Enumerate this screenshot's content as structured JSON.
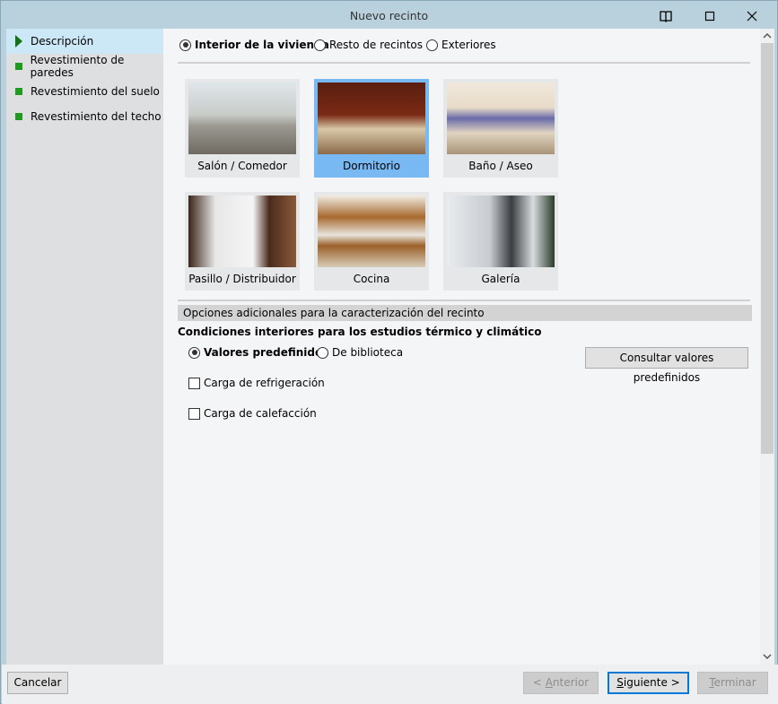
{
  "window": {
    "title": "Nuevo recinto"
  },
  "sidebar": {
    "items": [
      {
        "label": "Descripción",
        "selected": true
      },
      {
        "label": "Revestimiento de paredes"
      },
      {
        "label": "Revestimiento del suelo"
      },
      {
        "label": "Revestimiento del techo"
      }
    ]
  },
  "type_radios": [
    {
      "label": "Interior de la vivienda",
      "checked": true
    },
    {
      "label": "Resto de recintos",
      "checked": false
    },
    {
      "label": "Exteriores",
      "checked": false
    }
  ],
  "rooms": [
    {
      "label": "Salón / Comedor"
    },
    {
      "label": "Dormitorio",
      "selected": true
    },
    {
      "label": "Baño / Aseo"
    },
    {
      "label": "Pasillo / Distribuidor"
    },
    {
      "label": "Cocina"
    },
    {
      "label": "Galería"
    }
  ],
  "options": {
    "section_title": "Opciones adicionales para la caracterización del recinto",
    "conditions_title": "Condiciones interiores para los estudios térmico y climático",
    "radios": [
      {
        "label": "Valores predefinidos",
        "checked": true
      },
      {
        "label": "De biblioteca",
        "checked": false
      }
    ],
    "consult_button": "Consultar valores predefinidos",
    "checkboxes": [
      {
        "label": "Carga de refrigeración",
        "checked": false
      },
      {
        "label": "Carga de calefacción",
        "checked": false
      }
    ]
  },
  "footer": {
    "cancel": "Cancelar",
    "prev_a": "< ",
    "prev_u": "A",
    "prev_b": "nterior",
    "next_u": "S",
    "next_b": "iguiente >",
    "finish_u": "T",
    "finish_b": "erminar"
  }
}
